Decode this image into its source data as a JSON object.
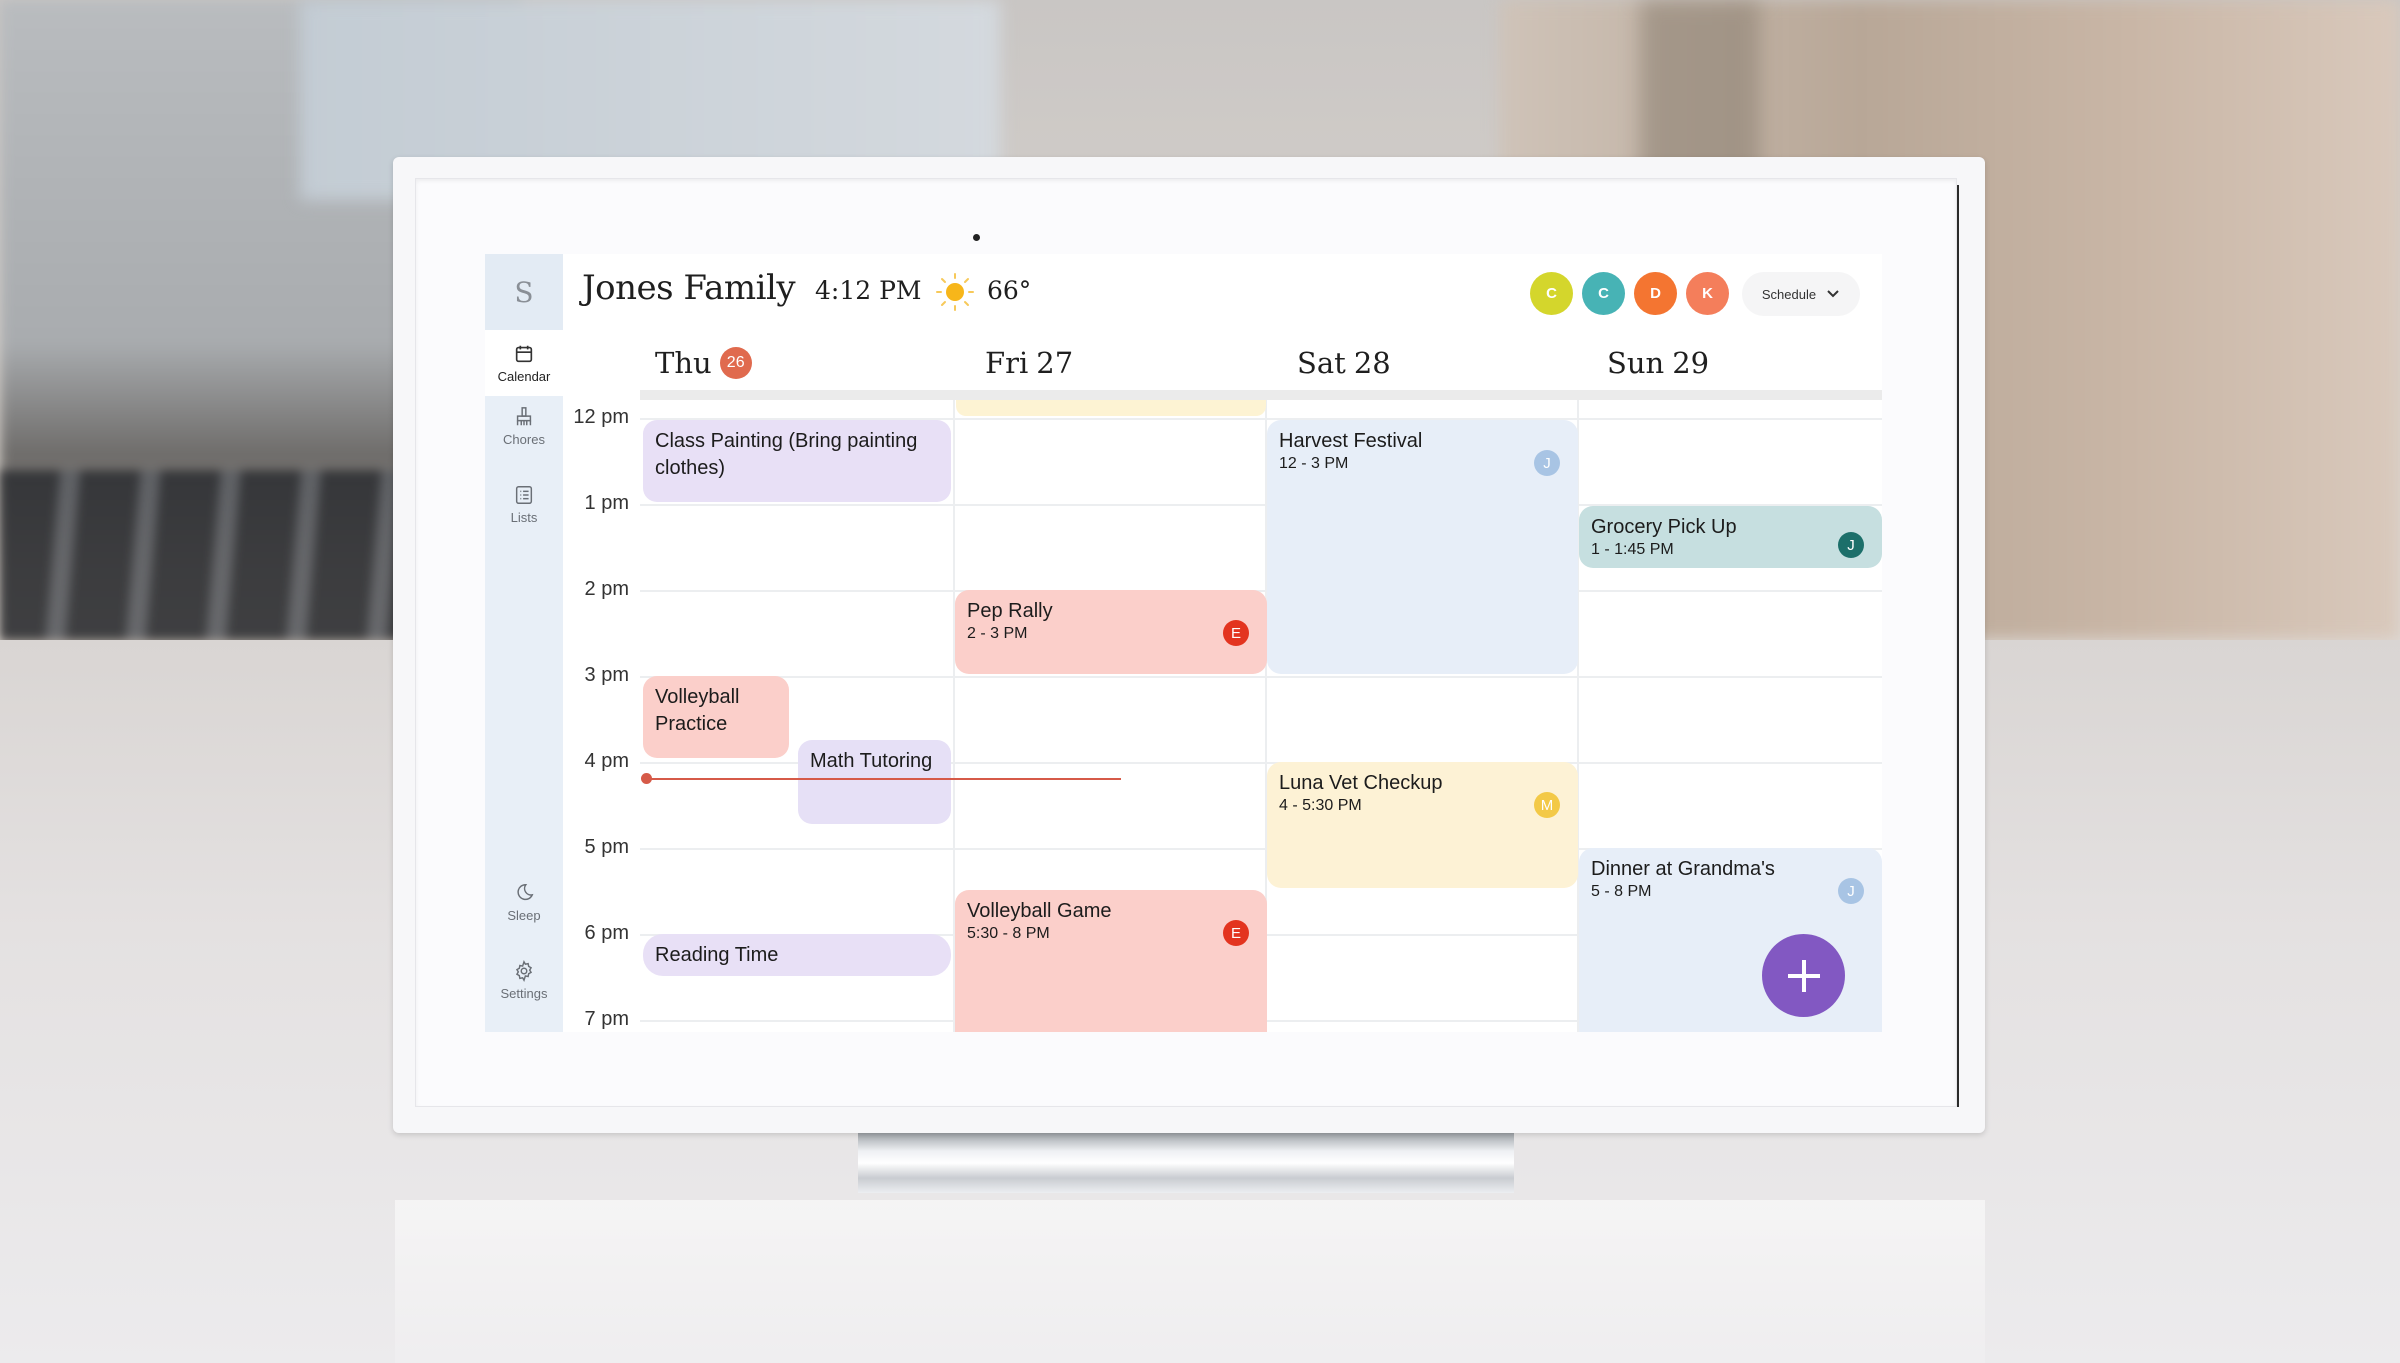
{
  "header": {
    "avatar_letter": "S",
    "family_name": "Jones Family",
    "time": "4:12 PM",
    "weather_icon": "sun-icon",
    "temperature": "66°",
    "members": [
      {
        "initial": "C",
        "color": "#d4d62c"
      },
      {
        "initial": "C",
        "color": "#47b3b5"
      },
      {
        "initial": "D",
        "color": "#f47531"
      },
      {
        "initial": "K",
        "color": "#f47e5b"
      }
    ],
    "view_selector": {
      "label": "Schedule",
      "icon": "chevron-down-icon"
    }
  },
  "sidebar": {
    "items": [
      {
        "label": "Calendar",
        "icon": "calendar-icon",
        "active": true
      },
      {
        "label": "Chores",
        "icon": "broom-icon",
        "active": false
      },
      {
        "label": "Lists",
        "icon": "list-icon",
        "active": false
      },
      {
        "label": "Sleep",
        "icon": "moon-icon",
        "active": false
      },
      {
        "label": "Settings",
        "icon": "gear-icon",
        "active": false
      }
    ]
  },
  "calendar": {
    "days": [
      {
        "name": "Thu",
        "date": "26",
        "today": true
      },
      {
        "name": "Fri",
        "date": "27",
        "today": false
      },
      {
        "name": "Sat",
        "date": "28",
        "today": false
      },
      {
        "name": "Sun",
        "date": "29",
        "today": false
      }
    ],
    "hours": [
      "12 pm",
      "1 pm",
      "2 pm",
      "3 pm",
      "4 pm",
      "5 pm",
      "6 pm",
      "7 pm"
    ],
    "current_time": "4:12 PM",
    "events": [
      {
        "title": "Class Painting (Bring painting clothes)",
        "time": "",
        "day": "Thu",
        "color": "#e8e0f6"
      },
      {
        "title": "Volleyball Practice",
        "time": "",
        "day": "Thu",
        "color": "#fbcfca"
      },
      {
        "title": "Math Tutoring",
        "time": "",
        "day": "Thu",
        "color": "#e6e0f6"
      },
      {
        "title": "Reading Time",
        "time": "",
        "day": "Thu",
        "color": "#e8e0f6"
      },
      {
        "title": "",
        "time": "",
        "day": "Fri",
        "color": "#fdf3d3"
      },
      {
        "title": "Pep Rally",
        "time": "2 - 3 PM",
        "day": "Fri",
        "color": "#fbcfca",
        "member": "E",
        "member_color": "#e3341f"
      },
      {
        "title": "Volleyball Game",
        "time": "5:30 - 8 PM",
        "day": "Fri",
        "color": "#fbcfca",
        "member": "E",
        "member_color": "#e3341f"
      },
      {
        "title": "Harvest Festival",
        "time": "12 - 3 PM",
        "day": "Sat",
        "color": "#e7eef8",
        "member": "J",
        "member_color": "#a8c4e4"
      },
      {
        "title": "Luna Vet Checkup",
        "time": "4 - 5:30 PM",
        "day": "Sat",
        "color": "#fdf2d5",
        "member": "M",
        "member_color": "#f3c947"
      },
      {
        "title": "Grocery Pick Up",
        "time": "1 - 1:45 PM",
        "day": "Sun",
        "color": "#c6dfe0",
        "member": "J",
        "member_color": "#1c6f6a"
      },
      {
        "title": "Dinner at Grandma's",
        "time": "5 - 8 PM",
        "day": "Sun",
        "color": "#e7eef8",
        "member": "J",
        "member_color": "#a8c4e4"
      }
    ]
  },
  "fab": {
    "icon": "plus-icon",
    "color": "#8258c2"
  }
}
